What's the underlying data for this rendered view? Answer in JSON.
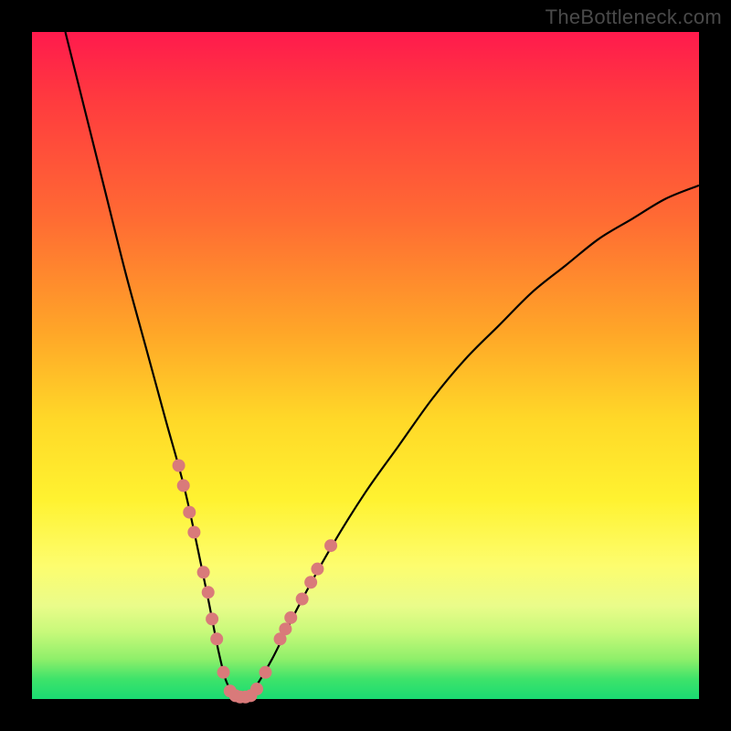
{
  "watermark": "TheBottleneck.com",
  "chart_data": {
    "type": "line",
    "title": "",
    "xlabel": "",
    "ylabel": "",
    "xlim": [
      0,
      100
    ],
    "ylim": [
      0,
      100
    ],
    "grid": false,
    "series": [
      {
        "name": "bottleneck-curve",
        "x": [
          5,
          8,
          11,
          14,
          17,
          20,
          23,
          26,
          27,
          28,
          29,
          30,
          31,
          32,
          33,
          36,
          40,
          45,
          50,
          55,
          60,
          65,
          70,
          75,
          80,
          85,
          90,
          95,
          100
        ],
        "y": [
          100,
          88,
          76,
          64,
          53,
          42,
          31,
          17,
          12,
          7,
          3,
          1,
          0,
          0,
          1,
          6,
          14,
          23,
          31,
          38,
          45,
          51,
          56,
          61,
          65,
          69,
          72,
          75,
          77
        ]
      }
    ],
    "markers": {
      "name": "highlight-dots",
      "color": "#d97a7a",
      "points": [
        {
          "x": 22.0,
          "y": 35
        },
        {
          "x": 22.7,
          "y": 32
        },
        {
          "x": 23.6,
          "y": 28
        },
        {
          "x": 24.3,
          "y": 25
        },
        {
          "x": 25.7,
          "y": 19
        },
        {
          "x": 26.4,
          "y": 16
        },
        {
          "x": 27.0,
          "y": 12
        },
        {
          "x": 27.7,
          "y": 9
        },
        {
          "x": 28.7,
          "y": 4
        },
        {
          "x": 29.7,
          "y": 1.2
        },
        {
          "x": 30.5,
          "y": 0.5
        },
        {
          "x": 31.2,
          "y": 0.3
        },
        {
          "x": 32.0,
          "y": 0.3
        },
        {
          "x": 32.8,
          "y": 0.5
        },
        {
          "x": 33.7,
          "y": 1.5
        },
        {
          "x": 35.0,
          "y": 4
        },
        {
          "x": 37.2,
          "y": 9
        },
        {
          "x": 38.0,
          "y": 10.5
        },
        {
          "x": 38.8,
          "y": 12.2
        },
        {
          "x": 40.5,
          "y": 15
        },
        {
          "x": 41.8,
          "y": 17.5
        },
        {
          "x": 42.8,
          "y": 19.5
        },
        {
          "x": 44.8,
          "y": 23
        }
      ]
    }
  }
}
